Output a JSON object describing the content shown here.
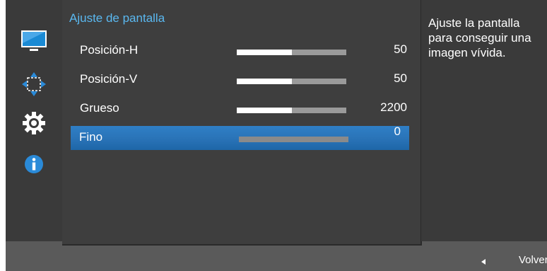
{
  "menu": {
    "title": "Ajuste de pantalla",
    "items": [
      {
        "label": "Posición-H",
        "value": "50",
        "level": 0.5,
        "selected": false
      },
      {
        "label": "Posición-V",
        "value": "50",
        "level": 0.5,
        "selected": false
      },
      {
        "label": "Grueso",
        "value": "2200",
        "level": 0.5,
        "selected": false
      },
      {
        "label": "Fino",
        "value": "0",
        "level": 0.0,
        "selected": true
      }
    ]
  },
  "sidebar": {
    "icons": [
      "monitor-icon",
      "move-arrows-icon",
      "gear-icon",
      "info-icon"
    ]
  },
  "info_panel": {
    "text": "Ajuste la pantalla para conseguir una imagen vívida."
  },
  "footer": {
    "back_label": "Volver",
    "back_icon": "left-triangle-icon"
  },
  "colors": {
    "accent": "#5ab8f0",
    "selected_row": "#2a74b8"
  }
}
